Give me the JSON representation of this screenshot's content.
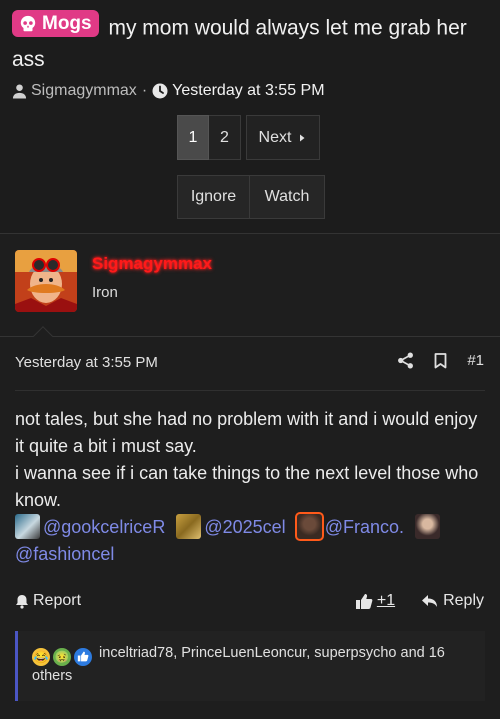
{
  "thread": {
    "tag": "Mogs",
    "title": "my mom would always let me grab her ass",
    "author": "Sigmagymmax",
    "time": "Yesterday at 3:55 PM"
  },
  "pagination": {
    "pages": [
      "1",
      "2"
    ],
    "next": "Next"
  },
  "thread_actions": {
    "ignore": "Ignore",
    "watch": "Watch"
  },
  "post": {
    "username": "Sigmagymmax",
    "user_title": "Iron",
    "time": "Yesterday at 3:55 PM",
    "number": "#1",
    "line1": "not tales, but she had no problem with it and i would enjoy it quite a bit i must say.",
    "line2": "i wanna see if i can take things to the next level those who know.",
    "mentions": [
      "@gookcelriceR",
      "@2025cel",
      "@Franco.",
      "@fashioncel"
    ],
    "report": "Report",
    "like_count": "+1",
    "reply": "Reply",
    "reactions_text": "inceltriad78, PrinceLuenLeoncur, superpsycho and 16 others"
  },
  "colors": {
    "accent": "#7f8ae6",
    "tag": "#e03a86",
    "username": "#ff1a1a",
    "reaction_bar": "#4b56c4"
  }
}
